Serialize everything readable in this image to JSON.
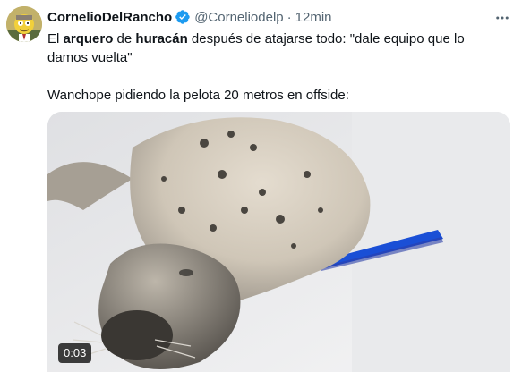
{
  "tweet": {
    "display_name": "CornelioDelRancho",
    "handle": "@Corneliodelp",
    "separator": "·",
    "time": "12min",
    "text": {
      "seg1": "El ",
      "bold1": "arquero",
      "seg2": " de ",
      "bold2": "huracán",
      "seg3": " después de atajarse todo: \"dale equipo que lo damos vuelta\"",
      "line2": "Wanchope pidiendo la pelota 20 metros en offside:"
    },
    "media": {
      "duration": "0:03"
    }
  },
  "icons": {
    "verified": "verified-badge-icon",
    "more": "more-options-icon",
    "avatar": "avatar"
  },
  "colors": {
    "verified_blue": "#1d9bf0",
    "secondary_text": "#536471",
    "primary_text": "#0f1419",
    "tape_blue": "#1a4fd6"
  }
}
